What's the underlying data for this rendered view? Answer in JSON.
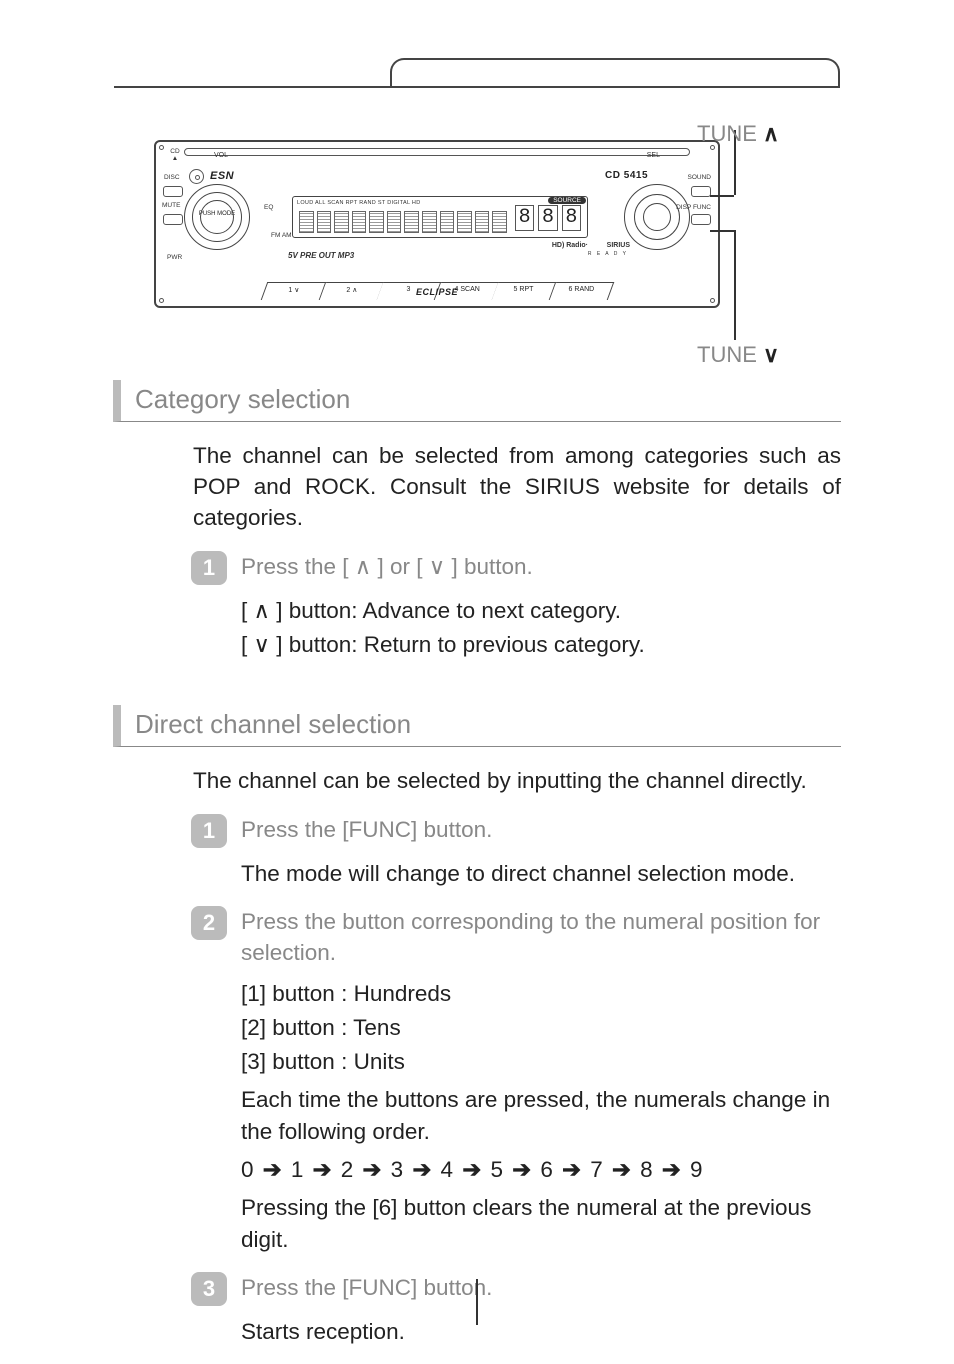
{
  "page_tab": "",
  "callouts": {
    "tune_up": "TUNE ∧",
    "tune_down": "TUNE ∨"
  },
  "radio": {
    "brand": "ESN",
    "model": "CD 5415",
    "labels": {
      "vol": "VOL",
      "sel": "SEL",
      "cd_eject": "CD\n▲",
      "disc": "DISC",
      "mute": "MUTE",
      "fm_am": "FM\nAM",
      "eq": "EQ",
      "pwr": "PWR",
      "preout": "5V PRE OUT  MP3",
      "source": "SOURCE",
      "sound": "SOUND",
      "disp_func": "DISP\nFUNC",
      "hd": "HD) Radio·",
      "sirius": "SIRIUS",
      "ready": "R E A D Y",
      "eclipse": "ECLIPSE",
      "knob_left": "PUSH MODE",
      "lcd_strip": "LOUD ALL SCAN RPT RAND ST DIGITAL HD"
    },
    "presets": [
      "1    ∨",
      "2    ∧",
      "3",
      "4  SCAN",
      "5   RPT",
      "6  RAND"
    ]
  },
  "section1": {
    "title": "Category selection",
    "intro": "The channel can be selected from among categories such as POP and ROCK. Consult the SIRIUS website for details of categories.",
    "step1": {
      "num": "1",
      "text": "Press the [ ∧ ] or [ ∨ ] button."
    },
    "lines": [
      "[ ∧ ] button: Advance to next category.",
      "[ ∨ ] button: Return to previous category."
    ]
  },
  "section2": {
    "title": "Direct channel selection",
    "intro": "The channel can be selected by inputting the channel directly.",
    "step1": {
      "num": "1",
      "text": "Press the [FUNC] button."
    },
    "note1": "The mode will change to direct channel selection mode.",
    "step2": {
      "num": "2",
      "text": "Press the button corresponding to the numeral position for selection."
    },
    "btn_lines": [
      "[1] button : Hundreds",
      "[2] button : Tens",
      "[3] button : Units"
    ],
    "each_press": "Each time the buttons are pressed, the numerals change in the following order.",
    "seq": [
      "0",
      "1",
      "2",
      "3",
      "4",
      "5",
      "6",
      "7",
      "8",
      "9"
    ],
    "press6": "Pressing the [6] button clears the numeral at the previous digit.",
    "step3": {
      "num": "3",
      "text": "Press the [FUNC] button."
    },
    "starts": "Starts reception."
  }
}
